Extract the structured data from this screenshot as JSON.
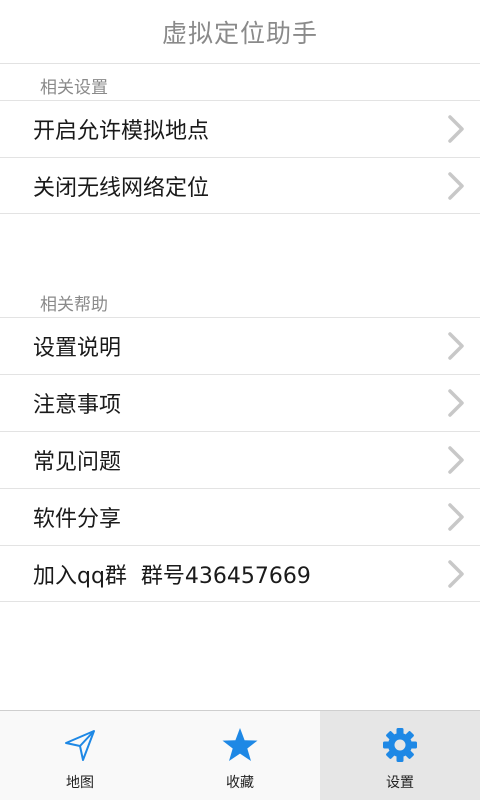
{
  "header": {
    "title": "虚拟定位助手"
  },
  "sections": [
    {
      "header": "相关设置",
      "items": [
        {
          "label": "开启允许模拟地点"
        },
        {
          "label": "关闭无线网络定位"
        }
      ]
    },
    {
      "header": "相关帮助",
      "items": [
        {
          "label": "设置说明"
        },
        {
          "label": "注意事项"
        },
        {
          "label": "常见问题"
        },
        {
          "label": "软件分享"
        },
        {
          "label": "加入qq群  群号436457669"
        }
      ]
    }
  ],
  "tabs": [
    {
      "label": "地图",
      "icon": "navigation-arrow-icon",
      "active": false
    },
    {
      "label": "收藏",
      "icon": "star-icon",
      "active": false
    },
    {
      "label": "设置",
      "icon": "gear-icon",
      "active": true
    }
  ],
  "colors": {
    "accent": "#1e88e5",
    "chevron": "#c8c8c8",
    "title_text": "#8a8a8a",
    "active_tab_bg": "#e6e6e6"
  }
}
